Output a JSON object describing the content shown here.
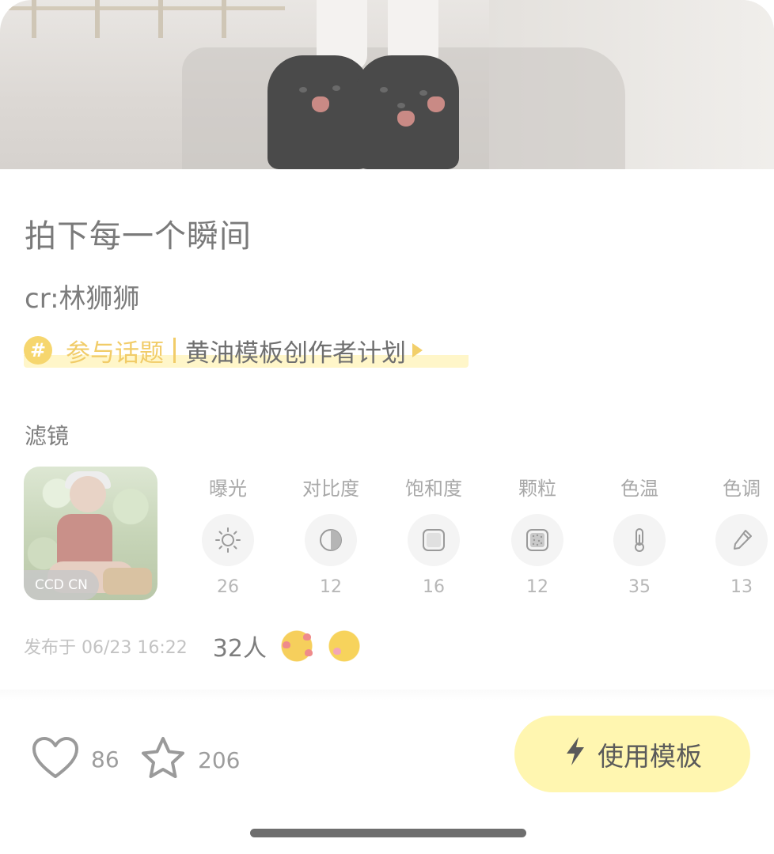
{
  "post": {
    "title": "拍下每一个瞬间",
    "credit": "cr:林狮狮",
    "topic": {
      "join_label": "参与话题",
      "name": "黄油模板创作者计划",
      "hash_symbol": "#"
    }
  },
  "filter": {
    "section_label": "滤镜",
    "preset_name": "CCD CN",
    "params": [
      {
        "label": "曝光",
        "value": "26",
        "icon": "sun-icon"
      },
      {
        "label": "对比度",
        "value": "12",
        "icon": "contrast-icon"
      },
      {
        "label": "饱和度",
        "value": "16",
        "icon": "saturation-icon"
      },
      {
        "label": "颗粒",
        "value": "12",
        "icon": "grain-icon"
      },
      {
        "label": "色温",
        "value": "35",
        "icon": "thermometer-icon"
      },
      {
        "label": "色调",
        "value": "13",
        "icon": "dropper-icon"
      }
    ]
  },
  "meta": {
    "published": "发布于 06/23 16:22",
    "reactions_count": "32人"
  },
  "actions": {
    "likes": "86",
    "favorites": "206",
    "use_template_label": "使用模板"
  },
  "colors": {
    "accent_yellow": "#fff6b0",
    "topic_yellow": "#f1cc68"
  }
}
